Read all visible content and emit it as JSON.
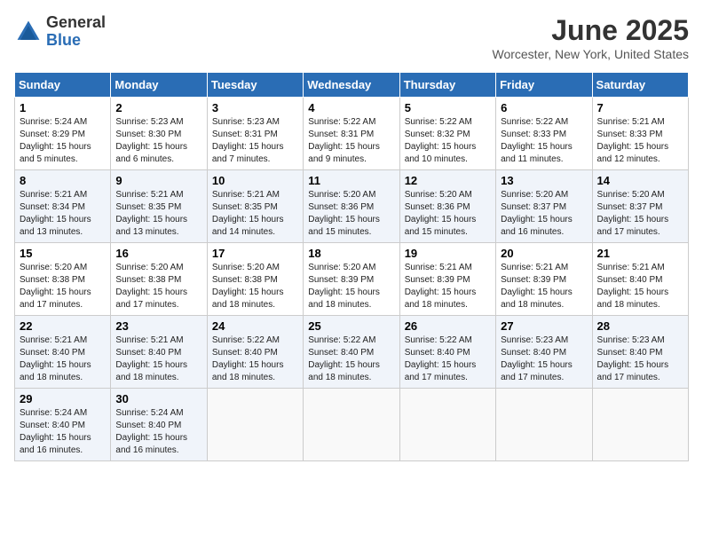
{
  "header": {
    "logo_general": "General",
    "logo_blue": "Blue",
    "month_title": "June 2025",
    "location": "Worcester, New York, United States"
  },
  "days_of_week": [
    "Sunday",
    "Monday",
    "Tuesday",
    "Wednesday",
    "Thursday",
    "Friday",
    "Saturday"
  ],
  "weeks": [
    [
      {
        "day": "1",
        "sunrise": "5:24 AM",
        "sunset": "8:29 PM",
        "daylight": "15 hours and 5 minutes."
      },
      {
        "day": "2",
        "sunrise": "5:23 AM",
        "sunset": "8:30 PM",
        "daylight": "15 hours and 6 minutes."
      },
      {
        "day": "3",
        "sunrise": "5:23 AM",
        "sunset": "8:31 PM",
        "daylight": "15 hours and 7 minutes."
      },
      {
        "day": "4",
        "sunrise": "5:22 AM",
        "sunset": "8:31 PM",
        "daylight": "15 hours and 9 minutes."
      },
      {
        "day": "5",
        "sunrise": "5:22 AM",
        "sunset": "8:32 PM",
        "daylight": "15 hours and 10 minutes."
      },
      {
        "day": "6",
        "sunrise": "5:22 AM",
        "sunset": "8:33 PM",
        "daylight": "15 hours and 11 minutes."
      },
      {
        "day": "7",
        "sunrise": "5:21 AM",
        "sunset": "8:33 PM",
        "daylight": "15 hours and 12 minutes."
      }
    ],
    [
      {
        "day": "8",
        "sunrise": "5:21 AM",
        "sunset": "8:34 PM",
        "daylight": "15 hours and 13 minutes."
      },
      {
        "day": "9",
        "sunrise": "5:21 AM",
        "sunset": "8:35 PM",
        "daylight": "15 hours and 13 minutes."
      },
      {
        "day": "10",
        "sunrise": "5:21 AM",
        "sunset": "8:35 PM",
        "daylight": "15 hours and 14 minutes."
      },
      {
        "day": "11",
        "sunrise": "5:20 AM",
        "sunset": "8:36 PM",
        "daylight": "15 hours and 15 minutes."
      },
      {
        "day": "12",
        "sunrise": "5:20 AM",
        "sunset": "8:36 PM",
        "daylight": "15 hours and 15 minutes."
      },
      {
        "day": "13",
        "sunrise": "5:20 AM",
        "sunset": "8:37 PM",
        "daylight": "15 hours and 16 minutes."
      },
      {
        "day": "14",
        "sunrise": "5:20 AM",
        "sunset": "8:37 PM",
        "daylight": "15 hours and 17 minutes."
      }
    ],
    [
      {
        "day": "15",
        "sunrise": "5:20 AM",
        "sunset": "8:38 PM",
        "daylight": "15 hours and 17 minutes."
      },
      {
        "day": "16",
        "sunrise": "5:20 AM",
        "sunset": "8:38 PM",
        "daylight": "15 hours and 17 minutes."
      },
      {
        "day": "17",
        "sunrise": "5:20 AM",
        "sunset": "8:38 PM",
        "daylight": "15 hours and 18 minutes."
      },
      {
        "day": "18",
        "sunrise": "5:20 AM",
        "sunset": "8:39 PM",
        "daylight": "15 hours and 18 minutes."
      },
      {
        "day": "19",
        "sunrise": "5:21 AM",
        "sunset": "8:39 PM",
        "daylight": "15 hours and 18 minutes."
      },
      {
        "day": "20",
        "sunrise": "5:21 AM",
        "sunset": "8:39 PM",
        "daylight": "15 hours and 18 minutes."
      },
      {
        "day": "21",
        "sunrise": "5:21 AM",
        "sunset": "8:40 PM",
        "daylight": "15 hours and 18 minutes."
      }
    ],
    [
      {
        "day": "22",
        "sunrise": "5:21 AM",
        "sunset": "8:40 PM",
        "daylight": "15 hours and 18 minutes."
      },
      {
        "day": "23",
        "sunrise": "5:21 AM",
        "sunset": "8:40 PM",
        "daylight": "15 hours and 18 minutes."
      },
      {
        "day": "24",
        "sunrise": "5:22 AM",
        "sunset": "8:40 PM",
        "daylight": "15 hours and 18 minutes."
      },
      {
        "day": "25",
        "sunrise": "5:22 AM",
        "sunset": "8:40 PM",
        "daylight": "15 hours and 18 minutes."
      },
      {
        "day": "26",
        "sunrise": "5:22 AM",
        "sunset": "8:40 PM",
        "daylight": "15 hours and 17 minutes."
      },
      {
        "day": "27",
        "sunrise": "5:23 AM",
        "sunset": "8:40 PM",
        "daylight": "15 hours and 17 minutes."
      },
      {
        "day": "28",
        "sunrise": "5:23 AM",
        "sunset": "8:40 PM",
        "daylight": "15 hours and 17 minutes."
      }
    ],
    [
      {
        "day": "29",
        "sunrise": "5:24 AM",
        "sunset": "8:40 PM",
        "daylight": "15 hours and 16 minutes."
      },
      {
        "day": "30",
        "sunrise": "5:24 AM",
        "sunset": "8:40 PM",
        "daylight": "15 hours and 16 minutes."
      },
      null,
      null,
      null,
      null,
      null
    ]
  ]
}
